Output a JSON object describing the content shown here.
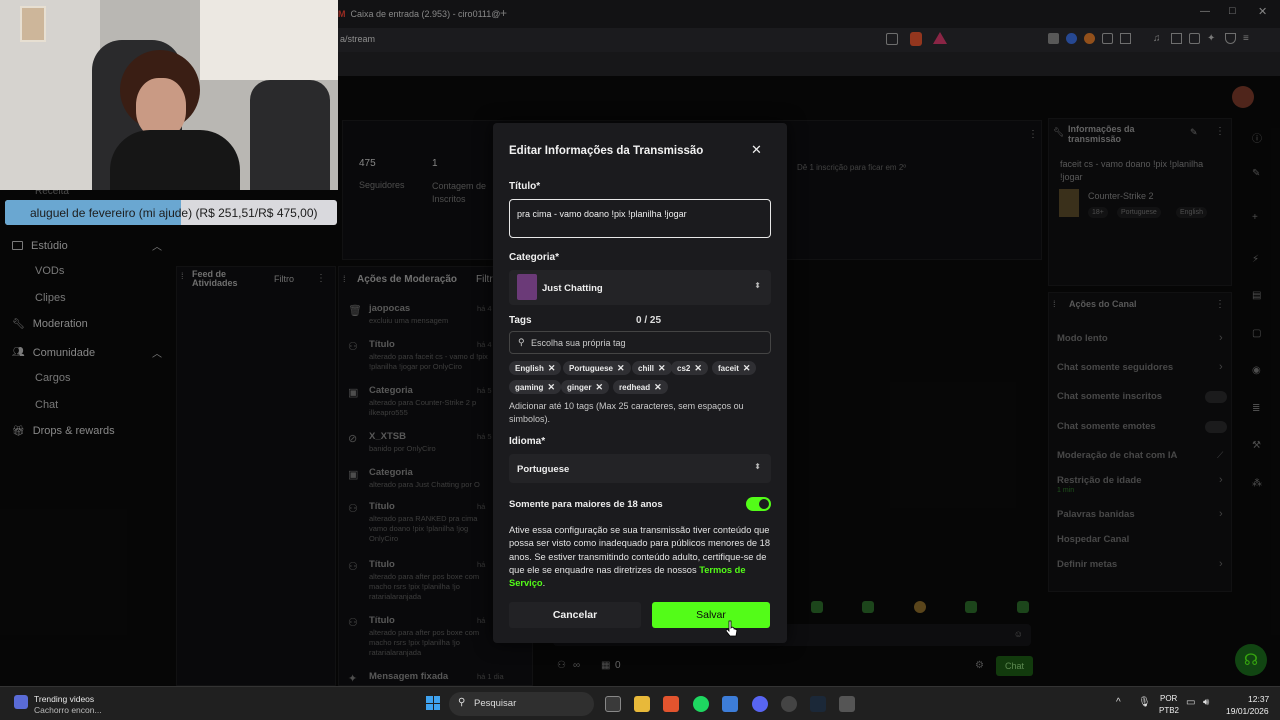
{
  "browser": {
    "tab_title": "Caixa de entrada (2.953) - ciro0111@",
    "new_tab": "+",
    "url_fragment": "a/stream",
    "min": "—",
    "max": "□",
    "close": "✕"
  },
  "sidebar": {
    "partial_top": "Receita",
    "items": [
      {
        "label": "Estúdio",
        "icon": "studio-icon"
      },
      {
        "label": "Moderation",
        "icon": "wrench-icon"
      },
      {
        "label": "Comunidade",
        "icon": "people-icon"
      },
      {
        "label": "Drops & rewards",
        "icon": "gift-icon"
      }
    ],
    "sub_estudio": [
      "VODs",
      "Clipes"
    ],
    "sub_comunidade": [
      "Cargos",
      "Chat"
    ]
  },
  "stats": {
    "followers_value": "475",
    "followers_label": "Seguidores",
    "subs_value": "1",
    "subs_label": "Contagem de Inscritos",
    "goal_text": "Dê 1 inscrição para ficar em 2º"
  },
  "goal_bar": {
    "text": "aluguel de fevereiro (mi ajude)",
    "amounts": "(R$ 251,51/R$ 475,00)",
    "progress": 0.53
  },
  "activity": {
    "title": "Feed de Atividades",
    "filter": "Filtro"
  },
  "modlog": {
    "title": "Ações de Moderação",
    "filter": "Filtr",
    "entries": [
      {
        "title": "jaopocas",
        "sub": "excluiu uma mensagem",
        "time": "há 4"
      },
      {
        "title": "Título",
        "sub": "alterado para faceit cs - vamo d !pix !planilha !jogar por OnlyCiro",
        "time": "há 4"
      },
      {
        "title": "Categoria",
        "sub": "alterado para Counter-Strike 2 p ilkeapro555",
        "time": "há 5"
      },
      {
        "title": "X_XTSB",
        "sub": "banido por OnlyCiro",
        "time": "há 5"
      },
      {
        "title": "Categoria",
        "sub": "alterado para Just Chatting por O",
        "time": ""
      },
      {
        "title": "Título",
        "sub": "alterado para RANKED pra cima vamo doano !pix !planilha !jog OnlyCiro",
        "time": "há"
      },
      {
        "title": "Título",
        "sub": "alterado para after pos boxe com macho rsrs !pix !planilha !jo ratarialaranjada",
        "time": "há"
      },
      {
        "title": "Título",
        "sub": "alterado para after pos boxe com macho rsrs !pix !planilha !jo ratarialaranjada",
        "time": "há"
      },
      {
        "title": "Mensagem fixada",
        "sub": "",
        "time": "há 1 dia"
      }
    ]
  },
  "stream_info": {
    "title": "Informações da transmissão",
    "stream_title": "faceit cs - vamo doano !pix !planilha !jogar",
    "category": "Counter-Strike 2",
    "tags": [
      "18+",
      "Portuguese",
      "English"
    ]
  },
  "channel_actions": {
    "title": "Ações do Canal",
    "items": [
      "Modo lento",
      "Chat somente seguidores",
      "Chat somente inscritos",
      "Chat somente emotes",
      "Moderação de chat com IA",
      "Restrição de idade",
      "Palavras banidas",
      "Hospedar Canal",
      "Definir metas"
    ],
    "age_sub": "1 min"
  },
  "chat_footer": {
    "count": "0",
    "chat_button": "Chat"
  },
  "modal": {
    "title": "Editar Informações da Transmissão",
    "title_label": "Título*",
    "title_value": "pra cima - vamo doano !pix !planilha !jogar",
    "category_label": "Categoria*",
    "category_value": "Just Chatting",
    "tags_label": "Tags",
    "tags_count": "0 / 25",
    "tags_placeholder": "Escolha sua própria tag",
    "tags": [
      "English",
      "Portuguese",
      "chill",
      "cs2",
      "faceit",
      "gaming",
      "ginger",
      "redhead"
    ],
    "tags_help": "Adicionar até 10 tags (Max 25 caracteres, sem espaços ou simbolos).",
    "language_label": "Idioma*",
    "language_value": "Portuguese",
    "adult_label": "Somente para maiores de 18 anos",
    "adult_on": true,
    "adult_text": "Ative essa configuração se sua transmissão tiver conteúdo que possa ser visto como inadequado para públicos menores de 18 anos. Se estiver transmitindo conteúdo adulto, certifique-se de que ele se enquadre nas diretrizes de nossos",
    "terms_link": "Termos de Serviço",
    "terms_end": ".",
    "cancel": "Cancelar",
    "save": "Salvar",
    "accent": "#53fc18"
  },
  "taskbar": {
    "trending_title": "Trending videos",
    "trending_sub": "Cachorro encon...",
    "search": "Pesquisar",
    "lang1": "POR",
    "lang2": "PTB2",
    "time": "12:37",
    "date": "19/01/2026"
  }
}
